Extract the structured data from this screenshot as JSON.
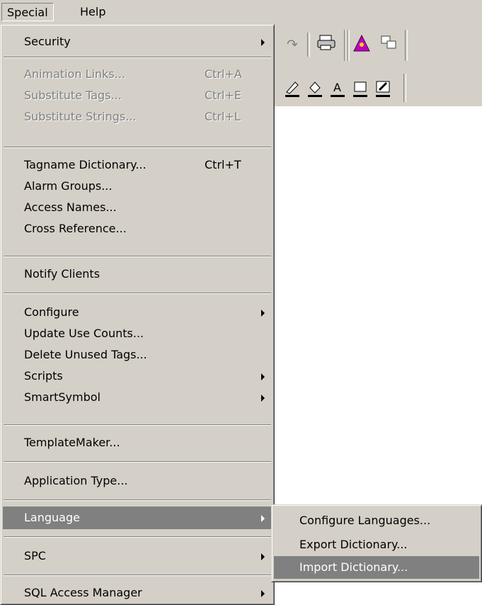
{
  "menubar": {
    "items": [
      "Special",
      "Help"
    ]
  },
  "special_menu": {
    "items": [
      {
        "label": "Security",
        "shortcut": "",
        "submenu": true,
        "disabled": false
      },
      {
        "label": "Animation Links...",
        "shortcut": "Ctrl+A",
        "submenu": false,
        "disabled": true
      },
      {
        "label": "Substitute Tags...",
        "shortcut": "Ctrl+E",
        "submenu": false,
        "disabled": true
      },
      {
        "label": "Substitute Strings...",
        "shortcut": "Ctrl+L",
        "submenu": false,
        "disabled": true
      },
      {
        "label": "Tagname Dictionary...",
        "shortcut": "Ctrl+T",
        "submenu": false,
        "disabled": false
      },
      {
        "label": "Alarm Groups...",
        "shortcut": "",
        "submenu": false,
        "disabled": false
      },
      {
        "label": "Access Names...",
        "shortcut": "",
        "submenu": false,
        "disabled": false
      },
      {
        "label": "Cross Reference...",
        "shortcut": "",
        "submenu": false,
        "disabled": false
      },
      {
        "label": "Notify Clients",
        "shortcut": "",
        "submenu": false,
        "disabled": false
      },
      {
        "label": "Configure",
        "shortcut": "",
        "submenu": true,
        "disabled": false
      },
      {
        "label": "Update Use Counts...",
        "shortcut": "",
        "submenu": false,
        "disabled": false
      },
      {
        "label": "Delete Unused Tags...",
        "shortcut": "",
        "submenu": false,
        "disabled": false
      },
      {
        "label": "Scripts",
        "shortcut": "",
        "submenu": true,
        "disabled": false
      },
      {
        "label": "SmartSymbol",
        "shortcut": "",
        "submenu": true,
        "disabled": false
      },
      {
        "label": "TemplateMaker...",
        "shortcut": "",
        "submenu": false,
        "disabled": false
      },
      {
        "label": "Application Type...",
        "shortcut": "",
        "submenu": false,
        "disabled": false
      },
      {
        "label": "Language",
        "shortcut": "",
        "submenu": true,
        "disabled": false,
        "highlighted": true
      },
      {
        "label": "SPC",
        "shortcut": "",
        "submenu": true,
        "disabled": false
      },
      {
        "label": "SQL Access Manager",
        "shortcut": "",
        "submenu": true,
        "disabled": false
      }
    ]
  },
  "language_submenu": {
    "items": [
      {
        "label": "Configure Languages..."
      },
      {
        "label": "Export Dictionary..."
      },
      {
        "label": "Import Dictionary...",
        "highlighted": true
      }
    ]
  },
  "toolbar": {
    "icons": [
      "redo-icon",
      "print-icon",
      "wizard-icon",
      "convert-icon",
      "line-color-icon",
      "fill-color-icon",
      "text-color-icon",
      "window-color-icon",
      "color-pen-icon"
    ]
  }
}
